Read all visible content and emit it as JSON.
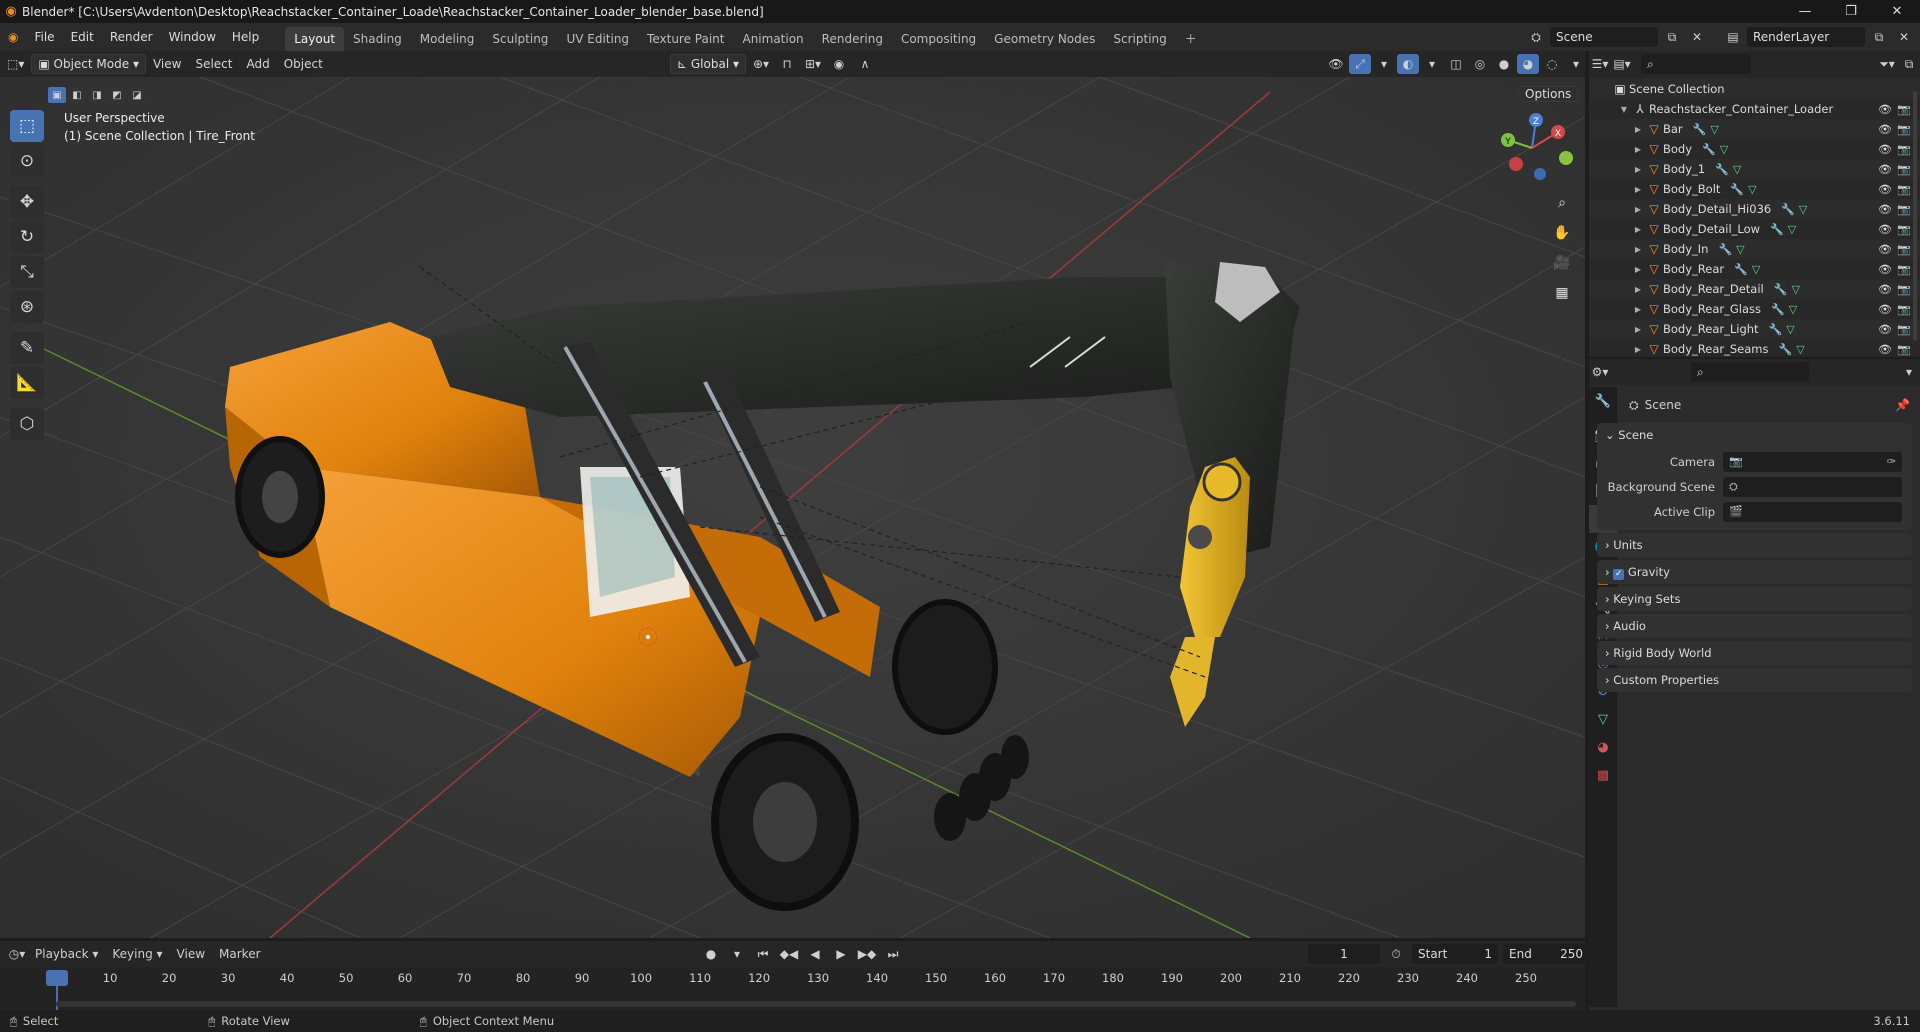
{
  "window": {
    "title": "Blender* [C:\\Users\\Avdenton\\Desktop\\Reachstacker_Container_Loade\\Reachstacker_Container_Loader_blender_base.blend]",
    "minimize": "—",
    "maximize": "❐",
    "close": "✕"
  },
  "menus": [
    "File",
    "Edit",
    "Render",
    "Window",
    "Help"
  ],
  "workspaces": [
    "Layout",
    "Shading",
    "Modeling",
    "Sculpting",
    "UV Editing",
    "Texture Paint",
    "Animation",
    "Rendering",
    "Compositing",
    "Geometry Nodes",
    "Scripting"
  ],
  "active_workspace": "Layout",
  "scene_name": "Scene",
  "view_layer": "RenderLayer",
  "viewport": {
    "mode": "Object Mode",
    "menus": [
      "View",
      "Select",
      "Add",
      "Object"
    ],
    "orientation": "Global",
    "options": "Options",
    "perspective": "User Perspective",
    "collection_info": "(1) Scene Collection | Tire_Front",
    "gizmo": {
      "x": "X",
      "y": "Y",
      "z": "Z"
    }
  },
  "outliner": {
    "root": "Scene Collection",
    "collection": "Reachstacker_Container_Loader",
    "objects": [
      "Bar",
      "Body",
      "Body_1",
      "Body_Bolt",
      "Body_Detail_Hi036",
      "Body_Detail_Low",
      "Body_In",
      "Body_Rear",
      "Body_Rear_Detail",
      "Body_Rear_Glass",
      "Body_Rear_Light",
      "Body_Rear_Seams"
    ]
  },
  "properties": {
    "context": "Scene",
    "panel_title": "Scene",
    "fields": [
      {
        "label": "Camera",
        "value": ""
      },
      {
        "label": "Background Scene",
        "value": ""
      },
      {
        "label": "Active Clip",
        "value": ""
      }
    ],
    "panels": [
      "Units",
      "Gravity",
      "Keying Sets",
      "Audio",
      "Rigid Body World",
      "Custom Properties"
    ]
  },
  "timeline": {
    "menus": [
      "Playback",
      "Keying",
      "View",
      "Marker"
    ],
    "current_frame": "1",
    "start_label": "Start",
    "start": "1",
    "end_label": "End",
    "end": "250",
    "ticks": [
      "1",
      "10",
      "20",
      "30",
      "40",
      "50",
      "60",
      "70",
      "80",
      "90",
      "100",
      "110",
      "120",
      "130",
      "140",
      "150",
      "160",
      "170",
      "180",
      "190",
      "200",
      "210",
      "220",
      "230",
      "240",
      "250"
    ]
  },
  "status": {
    "select": "Select",
    "rotate": "Rotate View",
    "context_menu": "Object Context Menu",
    "version": "3.6.11"
  },
  "colors": {
    "accent": "#4772b3",
    "object_orange": "#f08a24",
    "loader_orange": "#e8890f",
    "boom": "#2a2c2a"
  }
}
